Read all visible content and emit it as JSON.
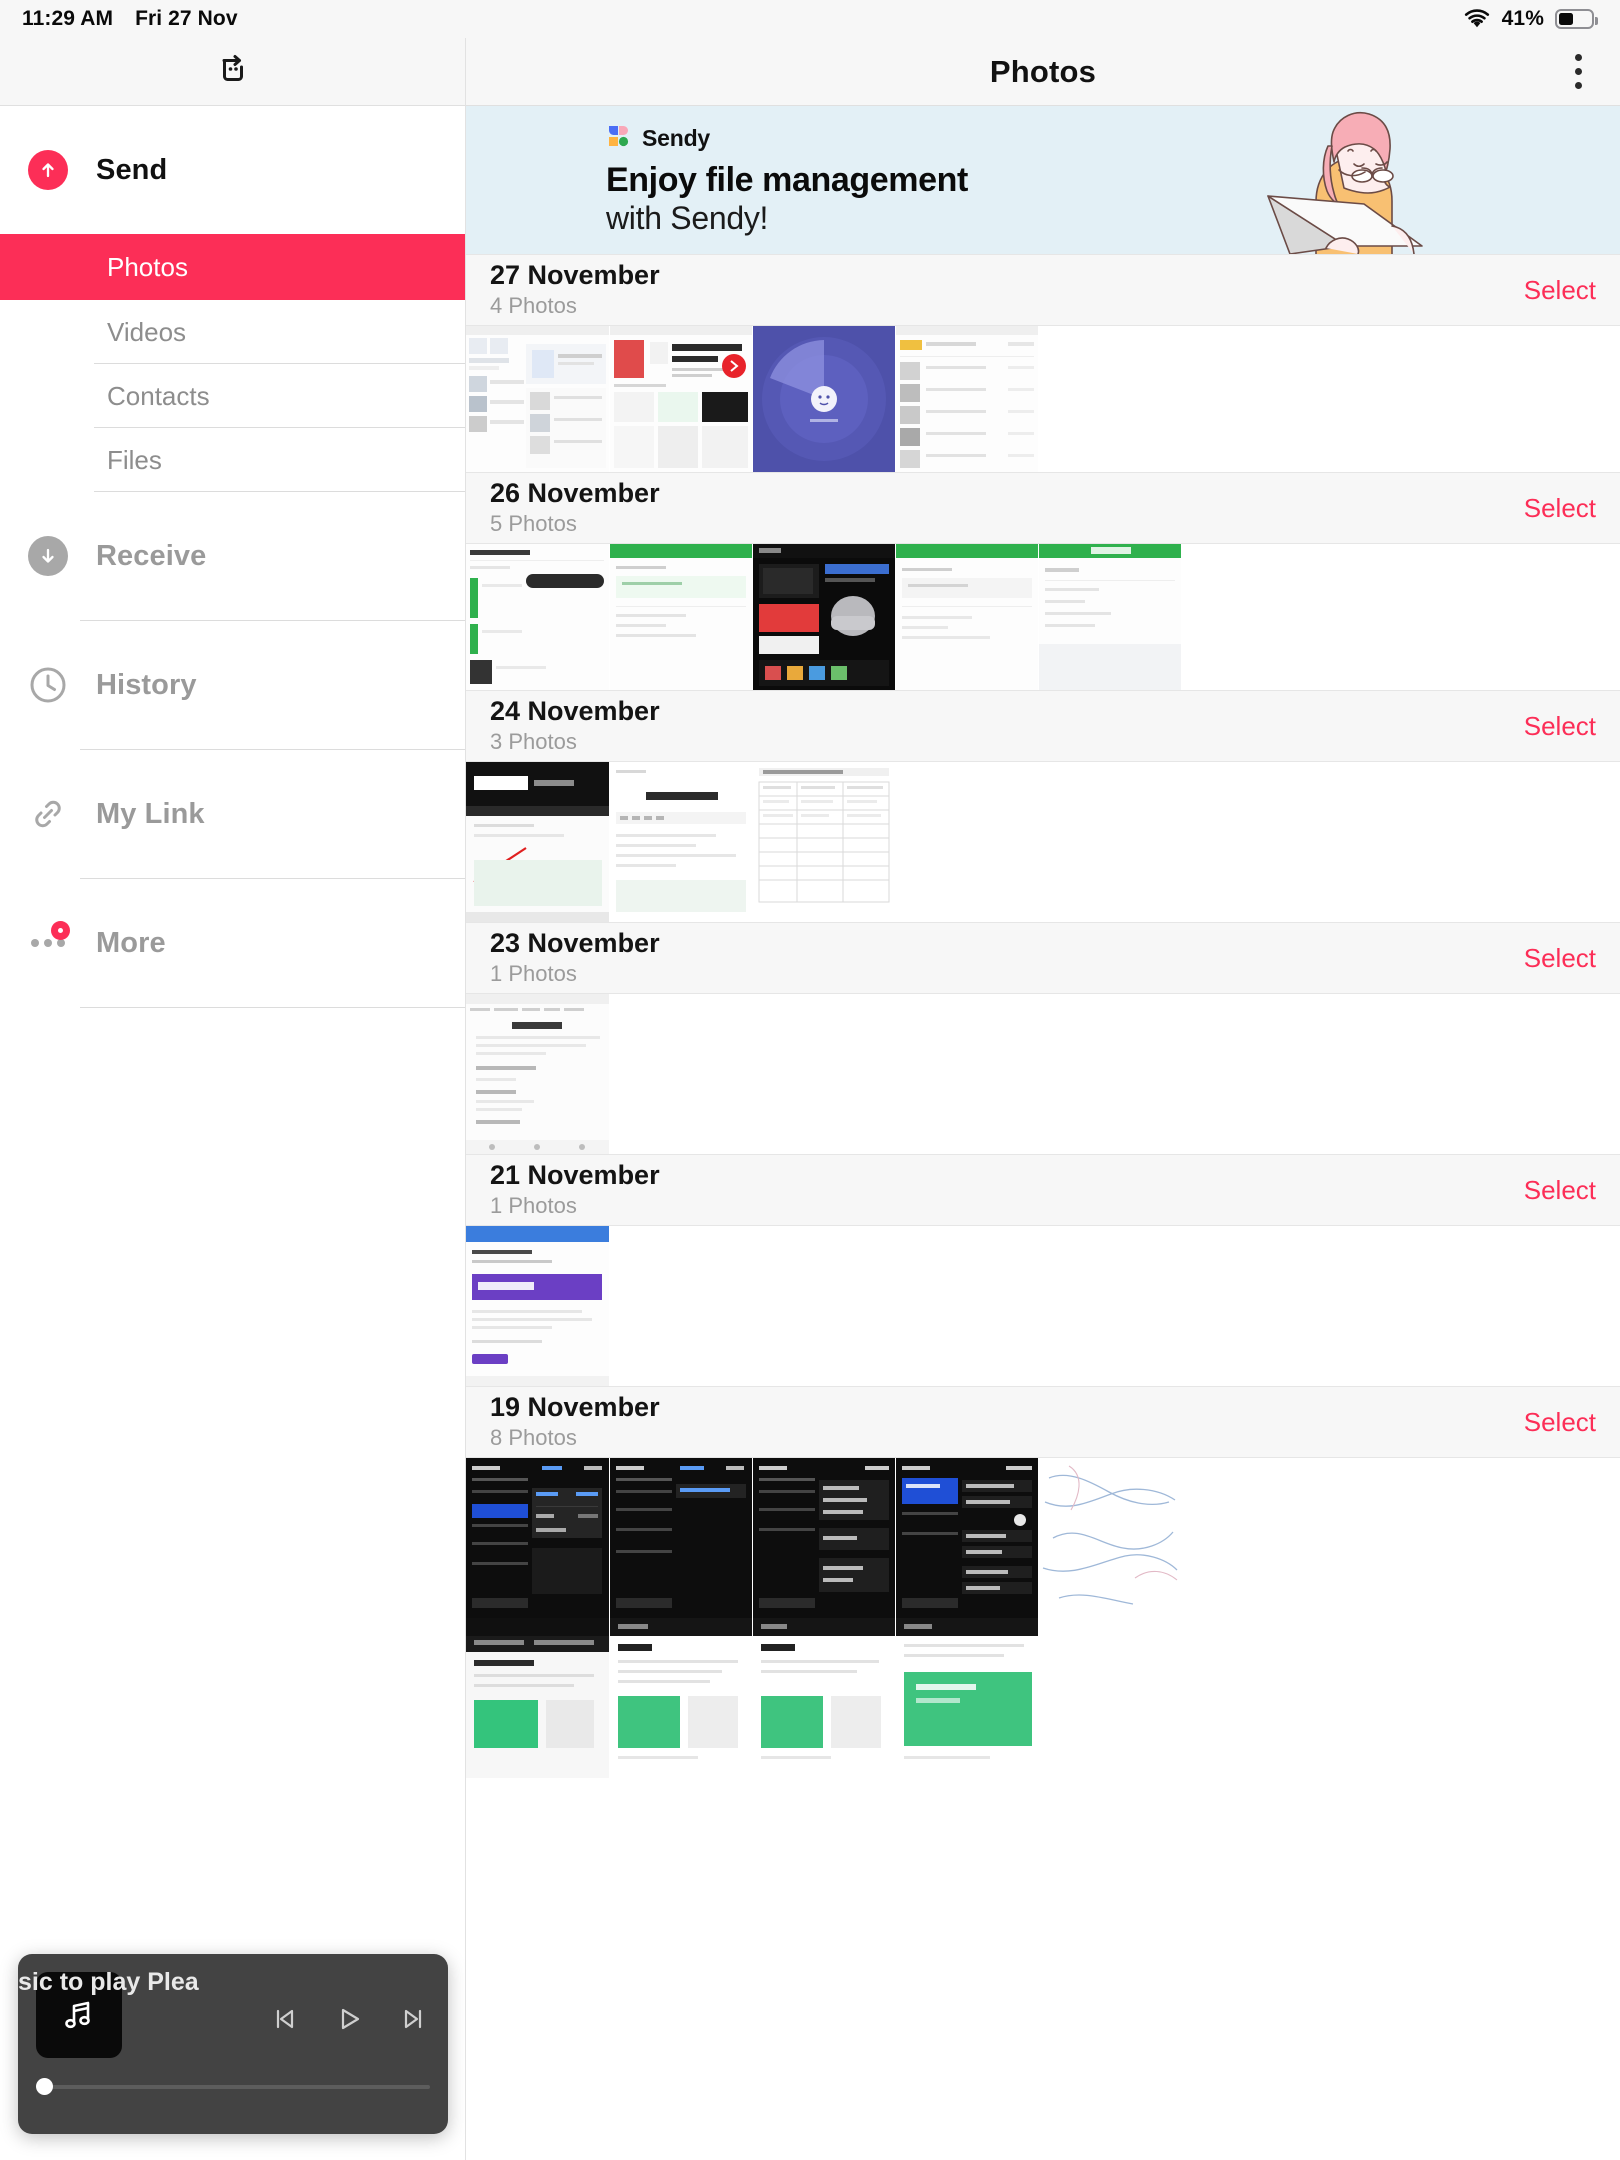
{
  "status_bar": {
    "time": "11:29 AM",
    "date": "Fri 27 Nov",
    "battery_percent": "41%",
    "wifi_icon": "wifi-icon",
    "battery_icon": "battery-icon",
    "battery_level": 41
  },
  "left_topbar": {
    "icon": "screen-mirroring-icon"
  },
  "right_topbar": {
    "title": "Photos",
    "menu_icon": "kebab-menu-icon"
  },
  "sidebar": {
    "send": {
      "label": "Send",
      "icon": "upload-arrow-icon",
      "items": [
        {
          "label": "Photos",
          "selected": true
        },
        {
          "label": "Videos",
          "selected": false
        },
        {
          "label": "Contacts",
          "selected": false
        },
        {
          "label": "Files",
          "selected": false
        }
      ]
    },
    "sections": [
      {
        "label": "Receive",
        "icon": "download-arrow-icon",
        "badge": false
      },
      {
        "label": "History",
        "icon": "clock-icon",
        "badge": false
      },
      {
        "label": "My Link",
        "icon": "link-icon",
        "badge": false
      },
      {
        "label": "More",
        "icon": "ellipsis-icon",
        "badge": true
      }
    ]
  },
  "music_player": {
    "title": "sic to play   Plea",
    "artwork_icon": "music-note-icon",
    "prev_icon": "skip-previous-icon",
    "play_icon": "play-icon",
    "next_icon": "skip-next-icon",
    "progress_percent": 0
  },
  "banner": {
    "brand": "Sendy",
    "logo_icon": "sendy-logo-icon",
    "headline": "Enjoy file management",
    "subline": "with Sendy!",
    "background_color": "#e3f0f6",
    "illustration": "woman-with-laptop-illustration"
  },
  "accent_color": "#fc2e57",
  "sections": [
    {
      "date": "27 November",
      "count": "4 Photos",
      "select_label": "Select",
      "thumbs": [
        "app-screenshot-photo-list",
        "app-screenshot-ads-page",
        "app-screenshot-radar-blue",
        "app-screenshot-file-list"
      ]
    },
    {
      "date": "26 November",
      "count": "5 Photos",
      "select_label": "Select",
      "thumbs": [
        "app-screenshot-share-photos",
        "app-screenshot-green-header",
        "app-screenshot-apple-mac-mini",
        "app-screenshot-green-header-2",
        "app-screenshot-loading-green"
      ]
    },
    {
      "date": "24 November",
      "count": "3 Photos",
      "select_label": "Select",
      "thumbs": [
        "app-screenshot-techlatest-dark",
        "app-screenshot-sample-post",
        "app-screenshot-mail-document"
      ]
    },
    {
      "date": "23 November",
      "count": "1 Photos",
      "select_label": "Select",
      "thumbs": [
        "app-screenshot-results-page"
      ]
    },
    {
      "date": "21 November",
      "count": "1 Photos",
      "select_label": "Select",
      "thumbs": [
        "app-screenshot-google-forms"
      ]
    },
    {
      "date": "19 November",
      "count": "8 Photos",
      "select_label": "Select",
      "thumbs": [
        "app-screenshot-settings-vpn",
        "app-screenshot-settings-vpn-2",
        "app-screenshot-settings-general",
        "app-screenshot-settings-apple-id",
        "app-screenshot-white-sketch"
      ],
      "thumbs_row2": [
        "app-screenshot-blog-dark",
        "app-screenshot-blog-pick",
        "app-screenshot-blog-green",
        "app-screenshot-blog-green-2"
      ]
    }
  ]
}
